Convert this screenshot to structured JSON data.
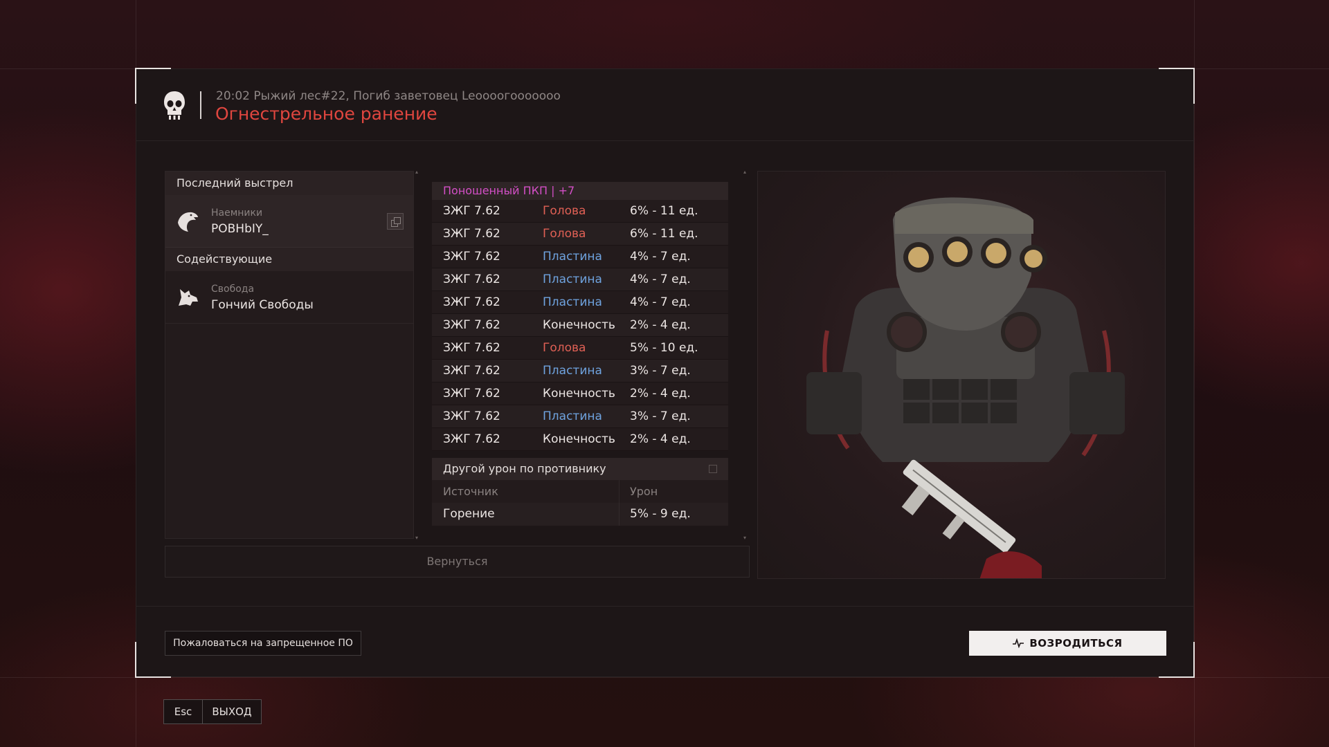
{
  "header": {
    "kill_line": "20:02 Рыжий лес#22, Погиб заветовец Leooooгooooooo",
    "cause": "Огнестрельное ранение"
  },
  "last_shot": {
    "title": "Последний выстрел",
    "faction": "Наемники",
    "player": "POBHbIY_"
  },
  "assisting": {
    "title": "Содействующие",
    "faction": "Свобода",
    "player": "Гончий Свободы"
  },
  "damage": {
    "weapon": "Поношенный ПКП | +7",
    "rows": [
      {
        "ammo": "ЗЖГ 7.62",
        "part": "Голова",
        "kind": "head",
        "dmg": "6% - 11 ед."
      },
      {
        "ammo": "ЗЖГ 7.62",
        "part": "Голова",
        "kind": "head",
        "dmg": "6% - 11 ед."
      },
      {
        "ammo": "ЗЖГ 7.62",
        "part": "Пластина",
        "kind": "plate",
        "dmg": "4% - 7 ед."
      },
      {
        "ammo": "ЗЖГ 7.62",
        "part": "Пластина",
        "kind": "plate",
        "dmg": "4% - 7 ед."
      },
      {
        "ammo": "ЗЖГ 7.62",
        "part": "Пластина",
        "kind": "plate",
        "dmg": "4% - 7 ед."
      },
      {
        "ammo": "ЗЖГ 7.62",
        "part": "Конечность",
        "kind": "limb",
        "dmg": "2% - 4 ед."
      },
      {
        "ammo": "ЗЖГ 7.62",
        "part": "Голова",
        "kind": "head",
        "dmg": "5% - 10 ед."
      },
      {
        "ammo": "ЗЖГ 7.62",
        "part": "Пластина",
        "kind": "plate",
        "dmg": "3% - 7 ед."
      },
      {
        "ammo": "ЗЖГ 7.62",
        "part": "Конечность",
        "kind": "limb",
        "dmg": "2% - 4 ед."
      },
      {
        "ammo": "ЗЖГ 7.62",
        "part": "Пластина",
        "kind": "plate",
        "dmg": "3% - 7 ед."
      },
      {
        "ammo": "ЗЖГ 7.62",
        "part": "Конечность",
        "kind": "limb",
        "dmg": "2% - 4 ед."
      }
    ]
  },
  "other_damage": {
    "title": "Другой урон по противнику",
    "col_source": "Источник",
    "col_damage": "Урон",
    "source": "Горение",
    "value": "5% - 9 ед."
  },
  "buttons": {
    "back": "Вернуться",
    "report": "Пожаловаться на запрещенное ПО",
    "respawn": "ВОЗРОДИТЬСЯ",
    "esc": "Esc",
    "exit": "ВЫХОД"
  },
  "colors": {
    "cause_red": "#e0463f",
    "weapon_purple": "#d44fc7",
    "head_red": "#e06055",
    "plate_blue": "#6fa3df"
  },
  "icons": {
    "header": "skull-icon",
    "killer_faction": "eagle-icon",
    "assist_faction": "wolf-icon",
    "copy": "copy-icon",
    "respawn": "pulse-icon"
  }
}
